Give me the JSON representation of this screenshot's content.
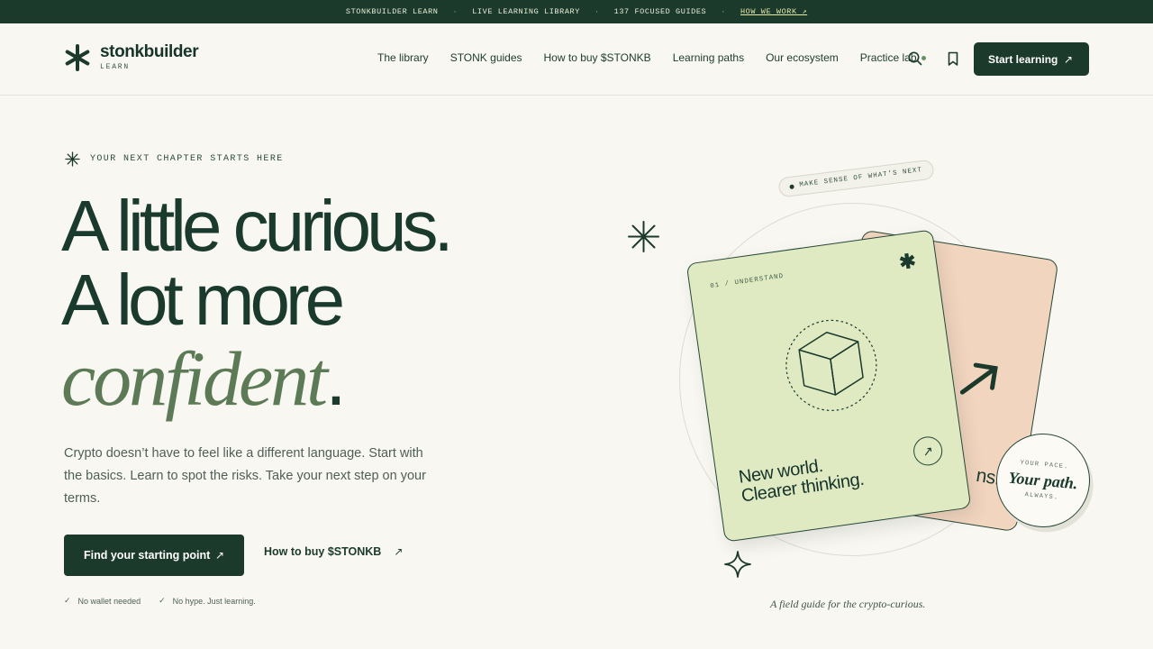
{
  "topbar": {
    "item1": "STONKBUILDER LEARN",
    "item2": "LIVE LEARNING LIBRARY",
    "item3": "137 FOCUSED GUIDES",
    "link": "HOW WE WORK ↗",
    "separator": "·"
  },
  "header": {
    "logo_name": "stonkbuilder",
    "logo_sub": "LEARN",
    "nav": [
      "The library",
      "STONK guides",
      "How to buy $STONKB",
      "Learning paths",
      "Our ecosystem",
      "Practice lab"
    ],
    "search_icon": "search-icon",
    "bookmark_icon": "bookmark-icon",
    "cta_label": "Start learning",
    "cta_arrow": "↗"
  },
  "hero": {
    "eyebrow": "YOUR NEXT CHAPTER STARTS HERE",
    "line1": "A little curious.",
    "line2": "A lot more",
    "line3": "confident",
    "line3_period": ".",
    "subcopy": "Crypto doesn’t have to feel like a different language. Start with the basics. Learn to spot the risks. Take your next step on your terms.",
    "primary_label": "Find your starting point",
    "primary_arrow": "↗",
    "secondary_label": "How to buy $STONKB",
    "secondary_arrow": "↗",
    "checks": [
      "No wallet needed",
      "No hype. Just learning."
    ],
    "check_glyph": "✓"
  },
  "illustration": {
    "pill_text": "MAKE SENSE OF WHAT’S NEXT",
    "card_label": "01 / UNDERSTAND",
    "card_title_1": "New world.",
    "card_title_2": "Clearer thinking.",
    "card_arrow": "↗",
    "card_back_text": "ns.",
    "card_asterisk": "✱",
    "badge_top": "YOUR PACE.",
    "badge_mid": "Your path.",
    "badge_bot": "ALWAYS.",
    "caption": "A field guide for the crypto-curious."
  },
  "colors": {
    "primary": "#1c3a2c",
    "accent_green": "#5c7a55",
    "card_green": "#dfeac3",
    "card_peach": "#f2d5bf",
    "background": "#f8f7f1"
  }
}
